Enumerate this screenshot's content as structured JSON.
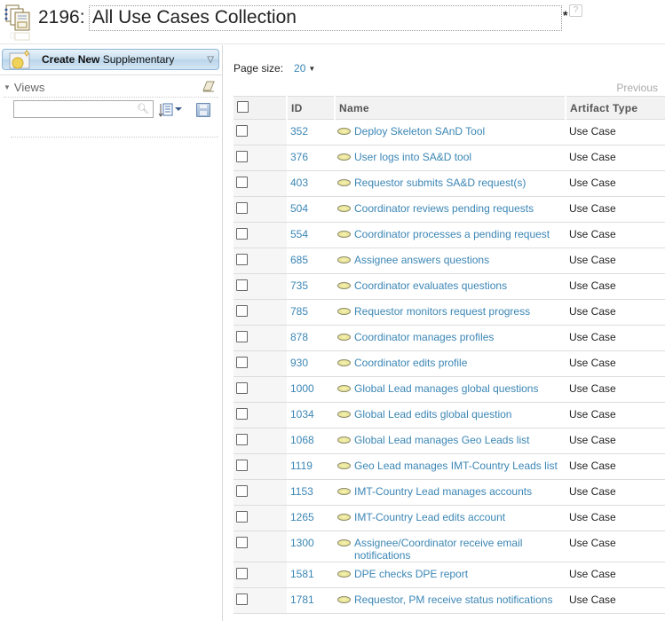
{
  "header": {
    "artifact_id": "2196:",
    "title": "All Use Cases Collection",
    "dirty_marker": "*",
    "help_label": "?"
  },
  "left_panel": {
    "create_button": {
      "bold": "Create New",
      "rest": "Supplementary"
    },
    "views": {
      "label": "Views",
      "search_value": "",
      "search_placeholder": ""
    }
  },
  "main": {
    "page_size_label": "Page size:",
    "page_size_value": "20",
    "previous_label": "Previous",
    "columns": [
      "ID",
      "Name",
      "Artifact Type"
    ],
    "rows": [
      {
        "id": "352",
        "name": "Deploy Skeleton SAnD Tool",
        "type": "Use Case"
      },
      {
        "id": "376",
        "name": "User logs into SA&D tool",
        "type": "Use Case"
      },
      {
        "id": "403",
        "name": "Requestor submits SA&D request(s)",
        "type": "Use Case"
      },
      {
        "id": "504",
        "name": "Coordinator reviews pending requests",
        "type": "Use Case"
      },
      {
        "id": "554",
        "name": "Coordinator processes a pending request",
        "type": "Use Case"
      },
      {
        "id": "685",
        "name": "Assignee answers questions",
        "type": "Use Case"
      },
      {
        "id": "735",
        "name": "Coordinator evaluates questions",
        "type": "Use Case"
      },
      {
        "id": "785",
        "name": "Requestor monitors request progress",
        "type": "Use Case"
      },
      {
        "id": "878",
        "name": "Coordinator manages profiles",
        "type": "Use Case"
      },
      {
        "id": "930",
        "name": "Coordinator edits profile",
        "type": "Use Case"
      },
      {
        "id": "1000",
        "name": "Global Lead manages global questions",
        "type": "Use Case"
      },
      {
        "id": "1034",
        "name": "Global Lead edits global question",
        "type": "Use Case"
      },
      {
        "id": "1068",
        "name": "Global Lead manages Geo Leads list",
        "type": "Use Case"
      },
      {
        "id": "1119",
        "name": "Geo Lead manages IMT-Country Leads list",
        "type": "Use Case"
      },
      {
        "id": "1153",
        "name": "IMT-Country Lead manages accounts",
        "type": "Use Case"
      },
      {
        "id": "1265",
        "name": "IMT-Country Lead edits account",
        "type": "Use Case"
      },
      {
        "id": "1300",
        "name": "Assignee/Coordinator receive email notifications",
        "type": "Use Case"
      },
      {
        "id": "1581",
        "name": "DPE checks DPE report",
        "type": "Use Case"
      },
      {
        "id": "1781",
        "name": "Requestor, PM receive status notifications",
        "type": "Use Case"
      }
    ]
  },
  "colors": {
    "link": "#3b86b5",
    "create_button_border": "#8fb7d6",
    "header_bg": "#f2f2f2"
  }
}
